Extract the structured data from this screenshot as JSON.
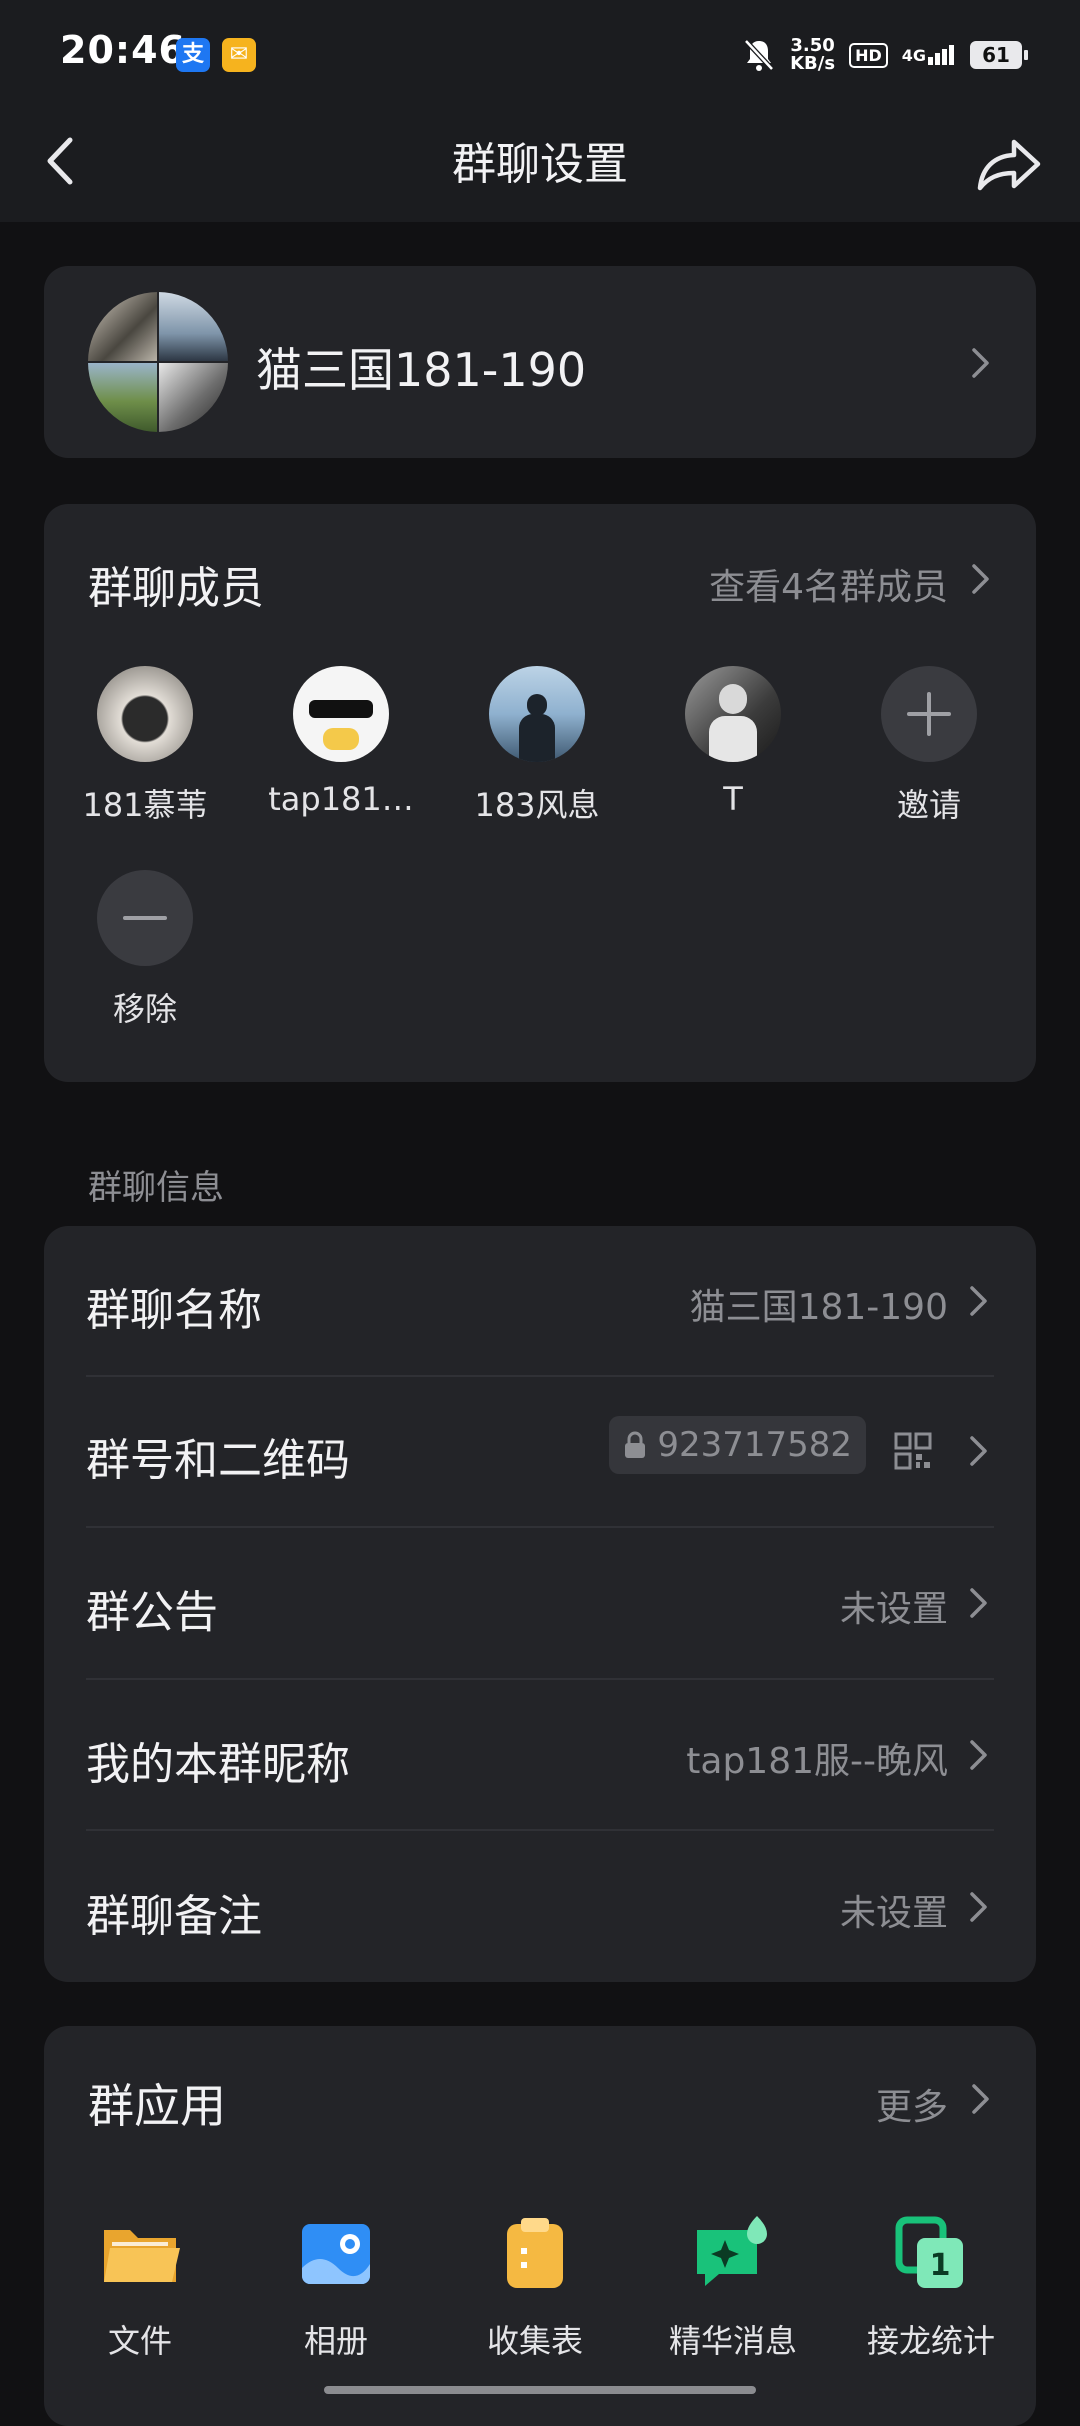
{
  "status_bar": {
    "time": "20:46",
    "speed_value": "3.50",
    "speed_unit": "KB/s",
    "hd": "HD",
    "network": "4G",
    "battery": "61"
  },
  "header": {
    "title": "群聊设置"
  },
  "group": {
    "name": "猫三国181-190"
  },
  "members": {
    "title": "群聊成员",
    "view_all": "查看4名群成员",
    "list": [
      {
        "name": "181慕苇"
      },
      {
        "name": "tap181…"
      },
      {
        "name": "183风息"
      },
      {
        "name": "T"
      }
    ],
    "invite_label": "邀请",
    "remove_label": "移除"
  },
  "info": {
    "caption": "群聊信息",
    "rows": [
      {
        "label": "群聊名称",
        "value": "猫三国181-190"
      },
      {
        "label": "群号和二维码",
        "value": "923717582"
      },
      {
        "label": "群公告",
        "value": "未设置"
      },
      {
        "label": "我的本群昵称",
        "value": "tap181服--晚风"
      },
      {
        "label": "群聊备注",
        "value": "未设置"
      }
    ]
  },
  "apps": {
    "title": "群应用",
    "more": "更多",
    "items": [
      {
        "label": "文件",
        "icon": "folder-icon"
      },
      {
        "label": "相册",
        "icon": "album-icon"
      },
      {
        "label": "收集表",
        "icon": "clipboard-icon"
      },
      {
        "label": "精华消息",
        "icon": "essence-message-icon"
      },
      {
        "label": "接龙统计",
        "icon": "chain-stats-icon"
      }
    ]
  },
  "colors": {
    "background": "#111113",
    "card": "#232428",
    "secondary_text": "#8d8e93",
    "folder": "#f5b942",
    "album": "#2f8ef5",
    "essence": "#19c27a"
  }
}
